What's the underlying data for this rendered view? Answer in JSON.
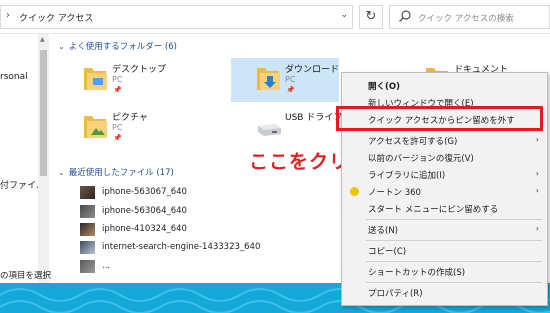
{
  "address": {
    "path": "クイック アクセス"
  },
  "search": {
    "placeholder": "クイック アクセスの検索"
  },
  "nav": {
    "items": [
      "rsonal",
      "付ファイル"
    ]
  },
  "frequent": {
    "header": "よく使用するフォルダー (6)",
    "folders": [
      {
        "name": "デスクトップ",
        "location": "PC"
      },
      {
        "name": "ダウンロード",
        "location": "PC"
      },
      {
        "name": "ドキュメント",
        "location": ""
      },
      {
        "name": "ピクチャ",
        "location": "PC"
      },
      {
        "name": "USB ドライブ (",
        "location": ""
      }
    ]
  },
  "recent": {
    "header": "最近使用したファイル (17)",
    "files": [
      "iphone-563067_640",
      "iphone-563064_640",
      "iphone-410324_640",
      "internet-search-engine-1433323_640",
      "..."
    ]
  },
  "status": {
    "text": "の項目を選択"
  },
  "annotation": {
    "text": "ここをクリック"
  },
  "context_menu": {
    "items": [
      {
        "label": "開く(O)",
        "bold": true
      },
      {
        "label": "新しいウィンドウで開く(E)"
      },
      {
        "label": "クイック アクセスからピン留めを外す"
      },
      {
        "label": "アクセスを許可する(G)",
        "arrow": true
      },
      {
        "label": "以前のバージョンの復元(V)"
      },
      {
        "label": "ライブラリに追加(I)",
        "arrow": true
      },
      {
        "label": "ノートン 360",
        "arrow": true
      },
      {
        "label": "スタート メニューにピン留めする"
      },
      {
        "label": "送る(N)",
        "arrow": true
      },
      {
        "label": "コピー(C)"
      },
      {
        "label": "ショートカットの作成(S)"
      },
      {
        "label": "プロパティ(R)"
      }
    ]
  },
  "colors": {
    "accent": "#1e4f91",
    "selection": "#cce6f8",
    "highlight": "#e21c1c",
    "taskbar": "#14a8d8"
  }
}
